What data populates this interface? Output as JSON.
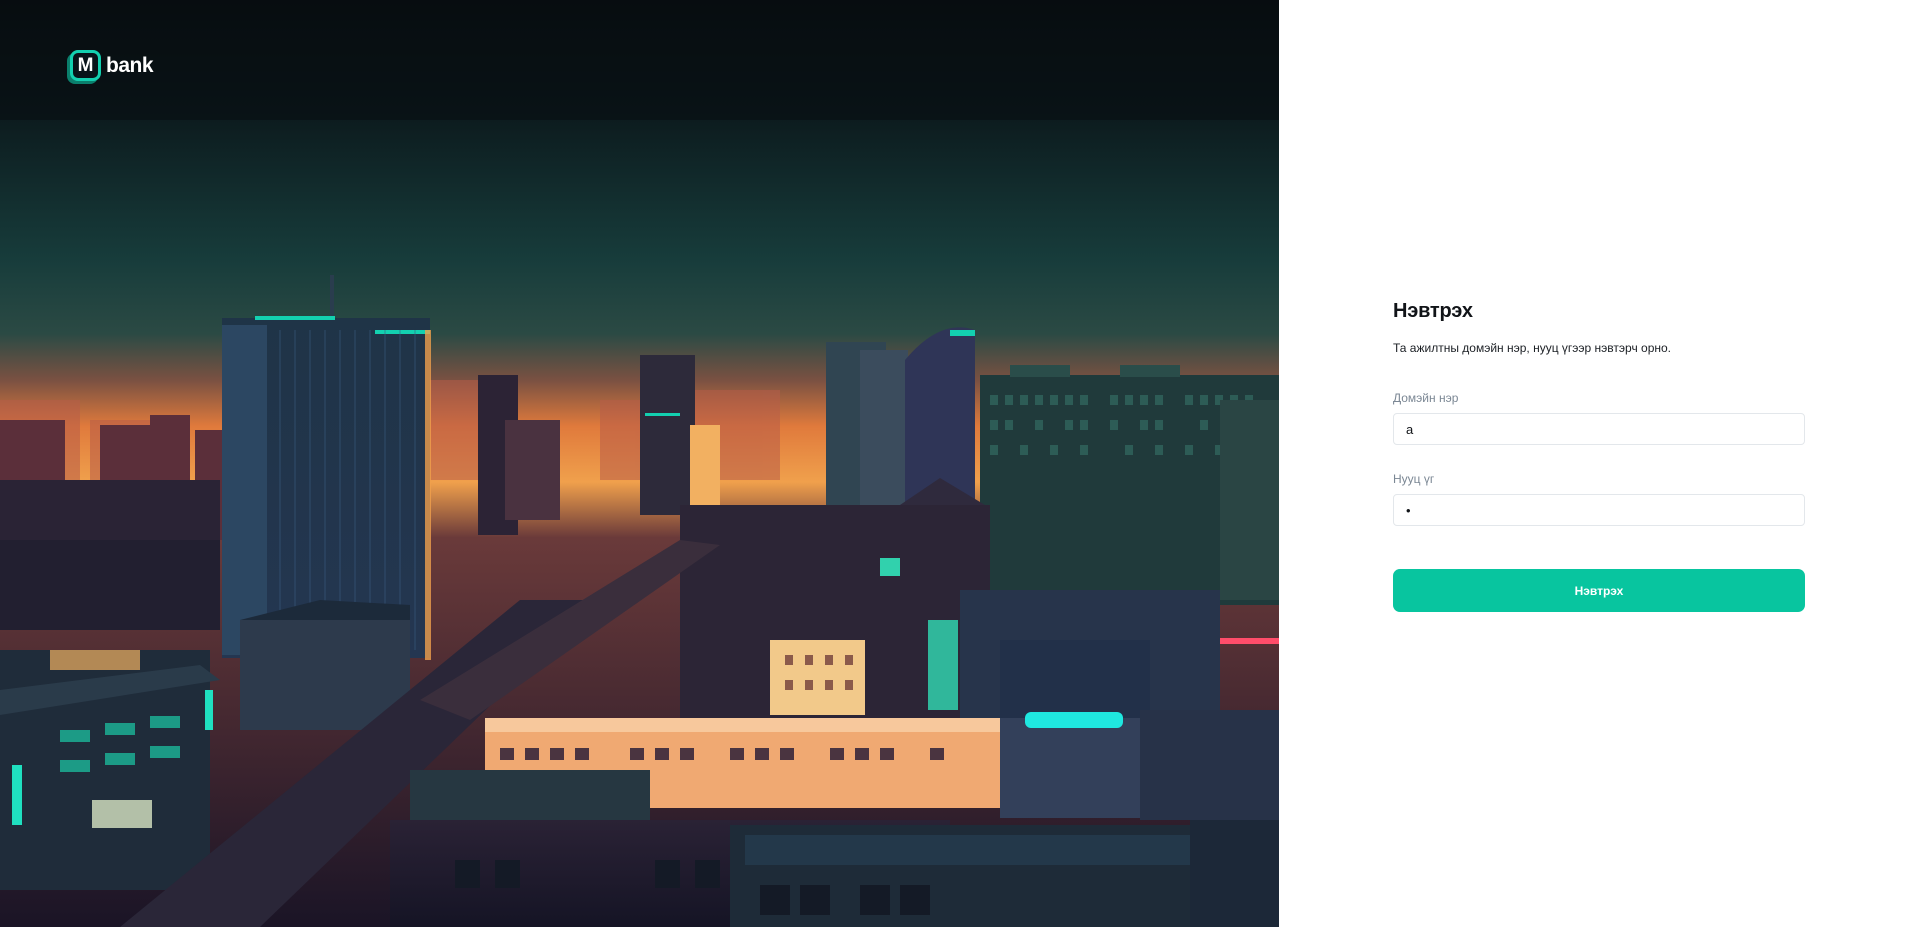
{
  "brand": {
    "logo_letter": "M",
    "logo_text": "bank"
  },
  "hero": {
    "image": "city-night-skyline-illustration"
  },
  "login": {
    "title": "Нэвтрэх",
    "subtitle": "Та ажилтны домэйн нэр, нууц үгээр нэвтэрч орно.",
    "domain_label": "Домэйн нэр",
    "domain_value": "a",
    "password_label": "Нууц үг",
    "password_value": "a",
    "submit_label": "Нэвтрэх"
  },
  "colors": {
    "accent": "#08c59f",
    "neon": "#13d0b0",
    "sky_top": "#0b1518",
    "sky_glow": "#e8803e"
  }
}
